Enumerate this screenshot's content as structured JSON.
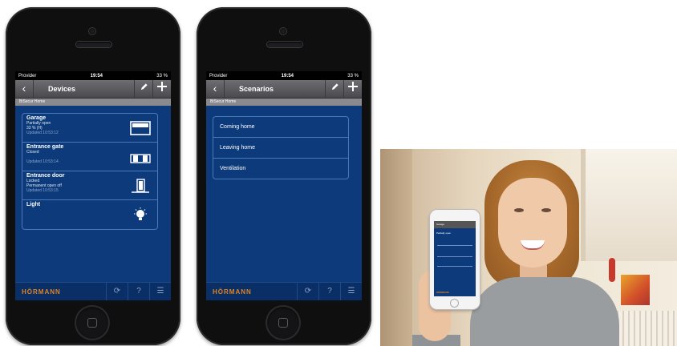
{
  "phone1": {
    "status": {
      "carrier": "Provider",
      "time": "19:54",
      "battery": "33 %"
    },
    "nav": {
      "back": "‹",
      "title": "Devices",
      "edit_icon": "pencil-icon",
      "add_icon": "plus-icon"
    },
    "subheader": "BiSecur Home",
    "devices": [
      {
        "name": "Garage",
        "line1": "Partially open",
        "line2": "33 % (H)",
        "updated": "Updated 10:53:12"
      },
      {
        "name": "Entrance gate",
        "line1": "Closed",
        "line2": "",
        "updated": "Updated 10:53:14"
      },
      {
        "name": "Entrance door",
        "line1": "Locked",
        "line2": "Permanent open off",
        "updated": "Updated 10:53:15"
      },
      {
        "name": "Light",
        "line1": "",
        "line2": "",
        "updated": ""
      }
    ],
    "footer": {
      "logo": "HÖRMANN",
      "refresh": "⟳",
      "help": "?",
      "menu": "☰"
    }
  },
  "phone2": {
    "status": {
      "carrier": "Provider",
      "time": "19:54",
      "battery": "33 %"
    },
    "nav": {
      "back": "‹",
      "title": "Scenarios",
      "edit_icon": "pencil-icon",
      "add_icon": "plus-icon"
    },
    "subheader": "BiSecur Home",
    "scenarios": [
      "Coming home",
      "Leaving home",
      "Ventilation"
    ],
    "footer": {
      "logo": "HÖRMANN",
      "refresh": "⟳",
      "help": "?",
      "menu": "☰"
    }
  },
  "photo": {
    "mini_title": "Garage",
    "mini_status": "Partially open",
    "mini_logo": "HÖRMANN"
  },
  "colors": {
    "screen_bg": "#0c3a7a",
    "accent": "#e4831e",
    "list_border": "#4a79b8"
  }
}
